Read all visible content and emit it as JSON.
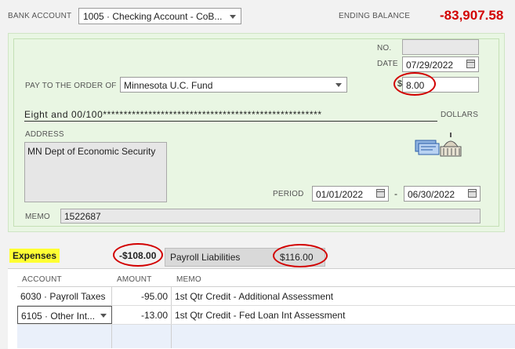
{
  "header": {
    "bank_account_label": "BANK ACCOUNT",
    "bank_account_value": "1005 · Checking Account - CoB...",
    "ending_balance_label": "ENDING BALANCE",
    "ending_balance_value": "-83,907.58"
  },
  "check": {
    "no_label": "NO.",
    "no_value": "",
    "date_label": "DATE",
    "date_value": "07/29/2022",
    "pay_to_label": "PAY TO THE ORDER OF",
    "payee": "Minnesota U.C. Fund",
    "currency_symbol": "$",
    "amount": "8.00",
    "written_amount": "Eight and 00/100*****************************************************",
    "dollars_label": "DOLLARS",
    "address_label": "ADDRESS",
    "address_value": "MN Dept of Economic Security",
    "period_label": "PERIOD",
    "period_from": "01/01/2022",
    "period_sep": "-",
    "period_to": "06/30/2022",
    "memo_label": "MEMO",
    "memo_value": "1522687"
  },
  "tabs": {
    "expenses_label": "Expenses",
    "expenses_amount": "-$108.00",
    "payroll_label": "Payroll Liabilities",
    "payroll_amount": "$116.00"
  },
  "table": {
    "headers": [
      "ACCOUNT",
      "AMOUNT",
      "MEMO"
    ],
    "rows": [
      {
        "account": "6030 · Payroll Taxes",
        "amount": "-95.00",
        "memo": "1st Qtr Credit - Additional Assessment"
      },
      {
        "account": "6105 · Other Int...",
        "amount": "-13.00",
        "memo": "1st Qtr Credit - Fed Loan Int Assessment"
      }
    ]
  },
  "colors": {
    "accent_red": "#d20000",
    "check_green": "#e9f6e3",
    "highlight_yellow": "#ffff33"
  },
  "icons": [
    "calendar-icon",
    "dropdown-caret-icon",
    "capitol-building-icon"
  ]
}
